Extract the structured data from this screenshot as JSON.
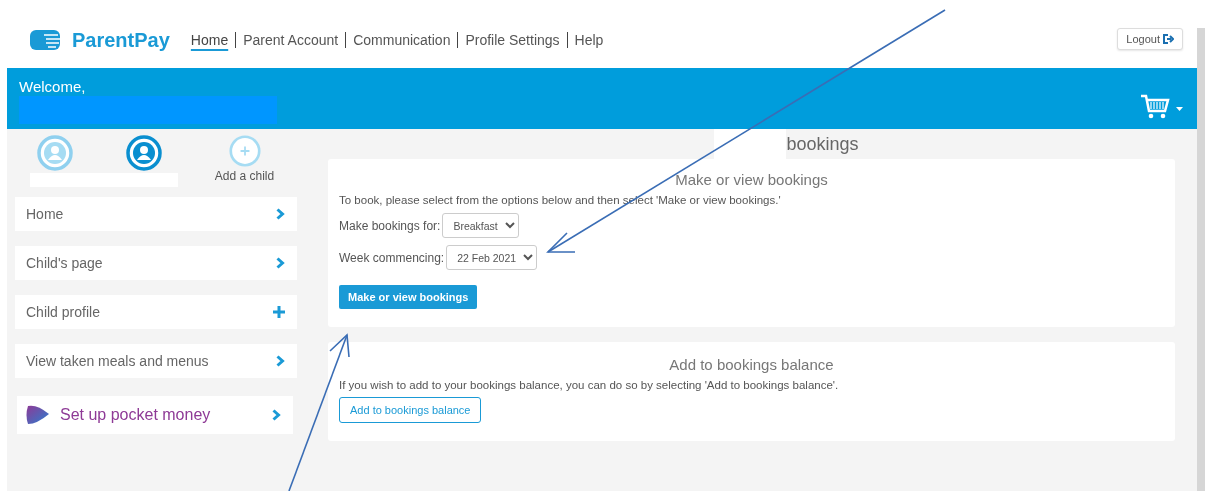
{
  "header": {
    "logo": "ParentPay",
    "nav": [
      {
        "label": "Home",
        "selected": true
      },
      {
        "label": "Parent Account",
        "selected": false
      },
      {
        "label": "Communication",
        "selected": false
      },
      {
        "label": "Profile Settings",
        "selected": false
      },
      {
        "label": "Help",
        "selected": false
      }
    ],
    "logout": "Logout"
  },
  "banner": {
    "greeting": "Welcome,"
  },
  "children": [
    {
      "selected": false
    },
    {
      "selected": true
    }
  ],
  "add_child": "Add a child",
  "sidebar": {
    "items": [
      {
        "label": "Home",
        "kind": "chevron"
      },
      {
        "label": "Child's page",
        "kind": "chevron"
      },
      {
        "label": "Child profile",
        "kind": "plus"
      },
      {
        "label": "View taken meals and menus",
        "kind": "chevron"
      },
      {
        "label": "Set up pocket money",
        "kind": "promo"
      }
    ]
  },
  "page_title": "bookings",
  "booking_card": {
    "title": "Make or view bookings",
    "instructions": "To book, please select from the options below and then select 'Make or view bookings.'",
    "fields": [
      {
        "label": "Make bookings for:",
        "value": "Breakfast"
      },
      {
        "label": "Week commencing:",
        "value": "22 Feb 2021"
      }
    ],
    "button": "Make or view bookings"
  },
  "balance_card": {
    "title": "Add to bookings balance",
    "text": "If you wish to add to your bookings balance, you can do so by selecting 'Add to bookings balance'.",
    "button": "Add to bookings balance"
  }
}
